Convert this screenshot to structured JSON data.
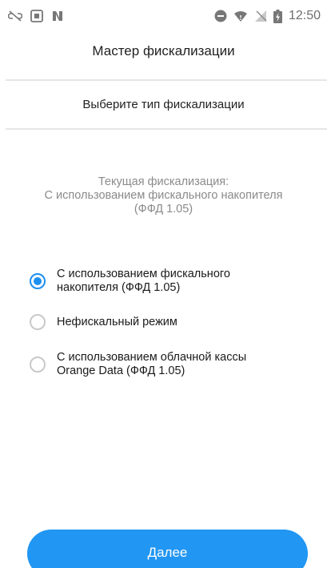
{
  "status_bar": {
    "time": "12:50",
    "left_icons": [
      "link-off-icon",
      "screenshot-icon",
      "nfc-icon"
    ],
    "right_icons": [
      "do-not-disturb-icon",
      "wifi-icon",
      "no-signal-icon",
      "battery-charging-icon"
    ]
  },
  "header": {
    "title": "Мастер фискализации"
  },
  "section": {
    "title": "Выберите тип фискализации"
  },
  "current": {
    "line1": "Текущая фискализация:",
    "line2": "С использованием фискального накопителя",
    "line3": "(ФФД 1.05)"
  },
  "options": [
    {
      "line1": "С использованием фискального",
      "line2": "накопителя (ФФД 1.05)",
      "selected": true
    },
    {
      "line1": "Нефискальный режим",
      "line2": "",
      "selected": false
    },
    {
      "line1": "С использованием облачной кассы",
      "line2": "Orange Data (ФФД 1.05)",
      "selected": false
    }
  ],
  "colors": {
    "accent": "#2196f3",
    "radio_selected": "#1d8ff0"
  },
  "next_button": {
    "label": "Далее"
  }
}
